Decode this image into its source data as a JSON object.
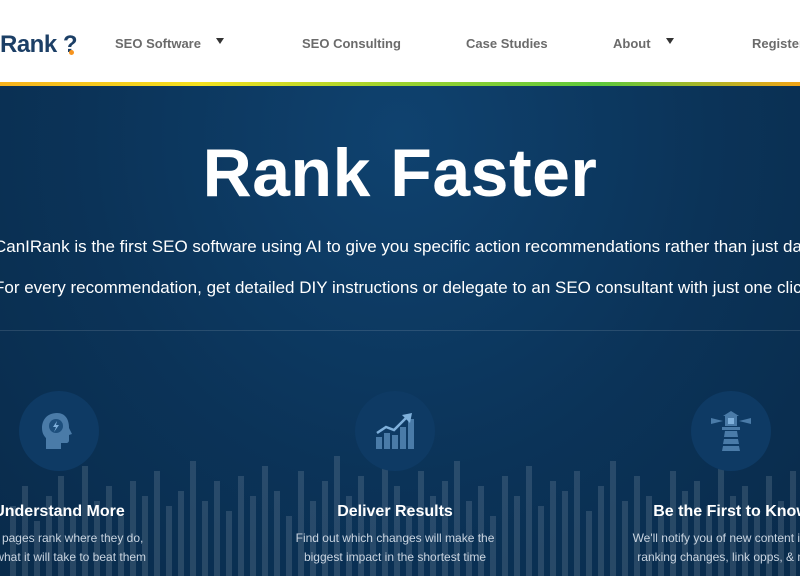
{
  "header": {
    "logo_text": "Rank",
    "logo_mark": "?",
    "nav": [
      {
        "label": "SEO Software",
        "has_dropdown": true
      },
      {
        "label": "SEO Consulting",
        "has_dropdown": false
      },
      {
        "label": "Case Studies",
        "has_dropdown": false
      },
      {
        "label": "About",
        "has_dropdown": true
      },
      {
        "label": "Register",
        "has_dropdown": false
      }
    ]
  },
  "hero": {
    "title": "Rank Faster",
    "line1": "CanIRank is the first SEO software using AI to give you specific action recommendations rather than just data.",
    "line2": "For every recommendation, get detailed DIY instructions or delegate to an SEO consultant with just one click."
  },
  "features": [
    {
      "icon": "brain-head-icon",
      "title": "Understand More",
      "desc1": "Why pages rank where they do,",
      "desc2": "and what it will take to beat them"
    },
    {
      "icon": "growth-chart-icon",
      "title": "Deliver Results",
      "desc1": "Find out which changes will make the",
      "desc2": "biggest impact in the shortest time"
    },
    {
      "icon": "lighthouse-icon",
      "title": "Be the First to Know",
      "desc1": "We'll notify you of new content ideas,",
      "desc2": "ranking changes, link opps, & more"
    }
  ],
  "colors": {
    "hero_bg": "#0b3358",
    "icon_circle": "#0e3a64",
    "icon_fill": "#4a7ba8",
    "logo_accent": "#f7941d"
  }
}
